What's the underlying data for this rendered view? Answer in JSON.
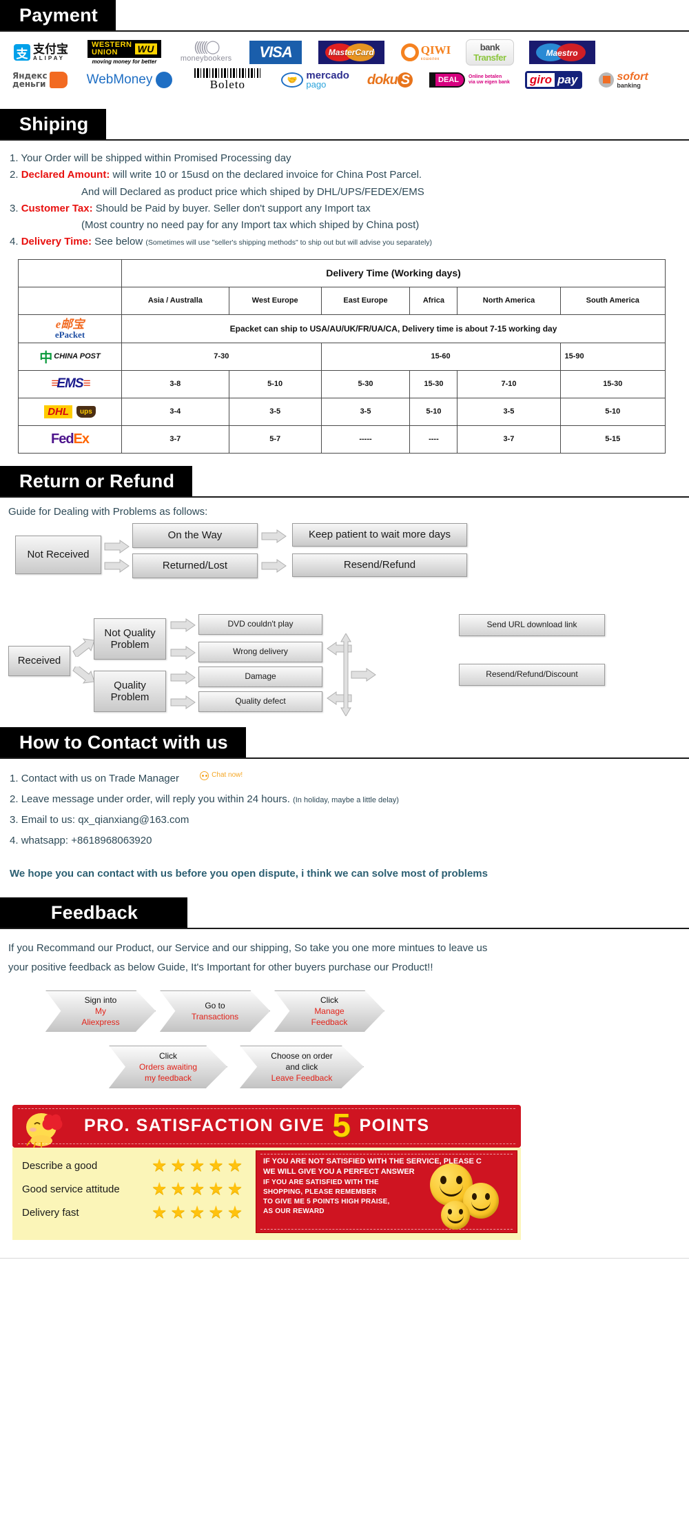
{
  "sections": {
    "payment": {
      "title": "Payment"
    },
    "shipping": {
      "title": "Shiping"
    },
    "return": {
      "title": "Return or Refund"
    },
    "contact": {
      "title": "How to Contact with us"
    },
    "feedback": {
      "title": "Feedback"
    }
  },
  "payment": {
    "row1": [
      {
        "id": "alipay",
        "cn": "支付宝",
        "en": "ALIPAY",
        "mark": "支"
      },
      {
        "id": "western-union",
        "line1": "WESTERN",
        "line2": "UNION",
        "badge": "WU",
        "sub": "moving money for better"
      },
      {
        "id": "moneybookers",
        "arcs": "((((( ",
        "label": "moneybookers"
      },
      {
        "id": "visa",
        "label": "VISA"
      },
      {
        "id": "mastercard",
        "label": "MasterCard"
      },
      {
        "id": "qiwi",
        "label": "QIWI",
        "sub": "кошелек"
      },
      {
        "id": "bank-transfer",
        "line1": "bank",
        "line2": "Transfer"
      },
      {
        "id": "maestro",
        "label": "Maestro"
      }
    ],
    "row2": [
      {
        "id": "yandex-money",
        "line1": "Яндекс",
        "line2": "деньги"
      },
      {
        "id": "webmoney",
        "label": "WebMoney"
      },
      {
        "id": "boleto",
        "label": "Boleto"
      },
      {
        "id": "mercado-pago",
        "line1": "mercado",
        "line2": "pago"
      },
      {
        "id": "doku",
        "label": "doku"
      },
      {
        "id": "ideal",
        "label": "DEAL",
        "sub1": "Online betalen",
        "sub2": "via uw eigen bank"
      },
      {
        "id": "giropay",
        "part1": "giro",
        "part2": "pay"
      },
      {
        "id": "sofort",
        "line1": "sofort",
        "line2": "banking"
      }
    ]
  },
  "shipping": {
    "items": [
      {
        "num": "1.",
        "label": "",
        "text": "Your Order will be shipped within Promised Processing day"
      },
      {
        "num": "2.",
        "label": "Declared Amount:",
        "text": "will write 10 or 15usd on the declared invoice for China Post Parcel."
      },
      {
        "num": "",
        "label": "",
        "text": "And will Declared as product price which shiped by DHL/UPS/FEDEX/EMS",
        "indent": true
      },
      {
        "num": "3.",
        "label": "Customer Tax:",
        "text": "Should be Paid by buyer. Seller don't support any Import tax"
      },
      {
        "num": "",
        "label": "",
        "text": "(Most country no need pay for any Import tax which shiped by China post)",
        "indent": true
      },
      {
        "num": "4.",
        "label": "Delivery Time:",
        "text": "See below",
        "note": "(Sometimes will use \"seller's shipping methods\" to ship out but will advise you separately)"
      }
    ]
  },
  "delivery_table": {
    "header_span": "Delivery Time (Working days)",
    "regions": [
      "Asia / Australla",
      "West Europe",
      "East Europe",
      "Africa",
      "North America",
      "South America"
    ],
    "rows": [
      {
        "carrier": "ePacket",
        "carrier_cn": "邮宝",
        "carrier_sub": "ePacket",
        "span_text": "Epacket can ship to USA/AU/UK/FR/UA/CA, Delivery time is about 7-15 working day"
      },
      {
        "carrier": "CHINA POST",
        "cells": [
          "7-30",
          "15-60",
          "15-90"
        ],
        "merge": [
          2,
          3,
          1
        ]
      },
      {
        "carrier": "EMS",
        "cells": [
          "3-8",
          "5-10",
          "5-30",
          "15-30",
          "7-10",
          "15-30"
        ]
      },
      {
        "carrier": "DHL UPS",
        "cells": [
          "3-4",
          "3-5",
          "3-5",
          "5-10",
          "3-5",
          "5-10"
        ]
      },
      {
        "carrier": "FedEx",
        "cells": [
          "3-7",
          "5-7",
          "-----",
          "----",
          "3-7",
          "5-15"
        ]
      }
    ]
  },
  "return_flow": {
    "guide": "Guide for Dealing with Problems as follows:",
    "chart1": {
      "root": "Not Received",
      "branches": [
        {
          "mid": "On the Way",
          "end": "Keep patient to wait more days"
        },
        {
          "mid": "Returned/Lost",
          "end": "Resend/Refund"
        }
      ]
    },
    "chart2": {
      "root": "Received",
      "branches": [
        {
          "mid": "Not Quality Problem",
          "mid_l1": "Not Quality",
          "mid_l2": "Problem",
          "items": [
            {
              "text": "DVD couldn't play",
              "end": "Send URL download link"
            },
            {
              "text": "Wrong delivery"
            }
          ]
        },
        {
          "mid": "Quality Problem",
          "mid_l1": "Quality",
          "mid_l2": "Problem",
          "items": [
            {
              "text": "Damage"
            },
            {
              "text": "Quality defect"
            }
          ]
        }
      ],
      "end": "Resend/Refund/Discount"
    }
  },
  "contact": {
    "items": [
      {
        "num": "1.",
        "text": "Contact with us on Trade Manager",
        "chat": "Chat now!"
      },
      {
        "num": "2.",
        "text": "Leave message under order, will reply you within 24 hours.",
        "note": "(In holiday, maybe a little delay)"
      },
      {
        "num": "3.",
        "text": "Email to us: qx_qianxiang@163.com"
      },
      {
        "num": "4.",
        "text": "whatsapp: +8618968063920"
      }
    ],
    "hope": "We hope you can contact with us before you open dispute, i think we can solve most of problems"
  },
  "feedback": {
    "intro_line1": "If you Recommand our Product, our Service and our shipping, So take you one more mintues to leave us",
    "intro_line2": "your positive feedback as below Guide, It's Important for other buyers purchase our Product!!",
    "steps": [
      {
        "black": "Sign into",
        "red1": "My",
        "red2": "Aliexpress"
      },
      {
        "black": "Go to",
        "red1": "Transactions"
      },
      {
        "black": "Click",
        "red1": "Manage",
        "red2": "Feedback"
      },
      {
        "black": "Click",
        "red1": "Orders awaiting",
        "red2": "my feedback"
      },
      {
        "black": "Choose on order",
        "black2": "and click",
        "red1": "Leave Feedback"
      }
    ]
  },
  "banner": {
    "text_before": "PRO. SATISFACTION  GIVE",
    "big": "5",
    "text_after": "POINTS",
    "rows": [
      {
        "label": "Describe a good",
        "stars": 5
      },
      {
        "label": "Good service attitude",
        "stars": 5
      },
      {
        "label": "Delivery fast",
        "stars": 5
      }
    ],
    "note_line1": "IF YOU ARE NOT SATISFIED WITH THE SERVICE, PLEASE C",
    "note_line2": "WE WILL GIVE YOU A PERFECT ANSWER",
    "note_body": "IF YOU ARE SATISFIED WITH THE\nSHOPPING, PLEASE REMEMBER\nTO GIVE ME 5 POINTS HIGH PRAISE,\nAS OUR REWARD",
    "colors": {
      "red": "#cf1421",
      "yellow": "#ffd400",
      "cream": "#fbf5b8",
      "star": "#ffc20e"
    }
  }
}
